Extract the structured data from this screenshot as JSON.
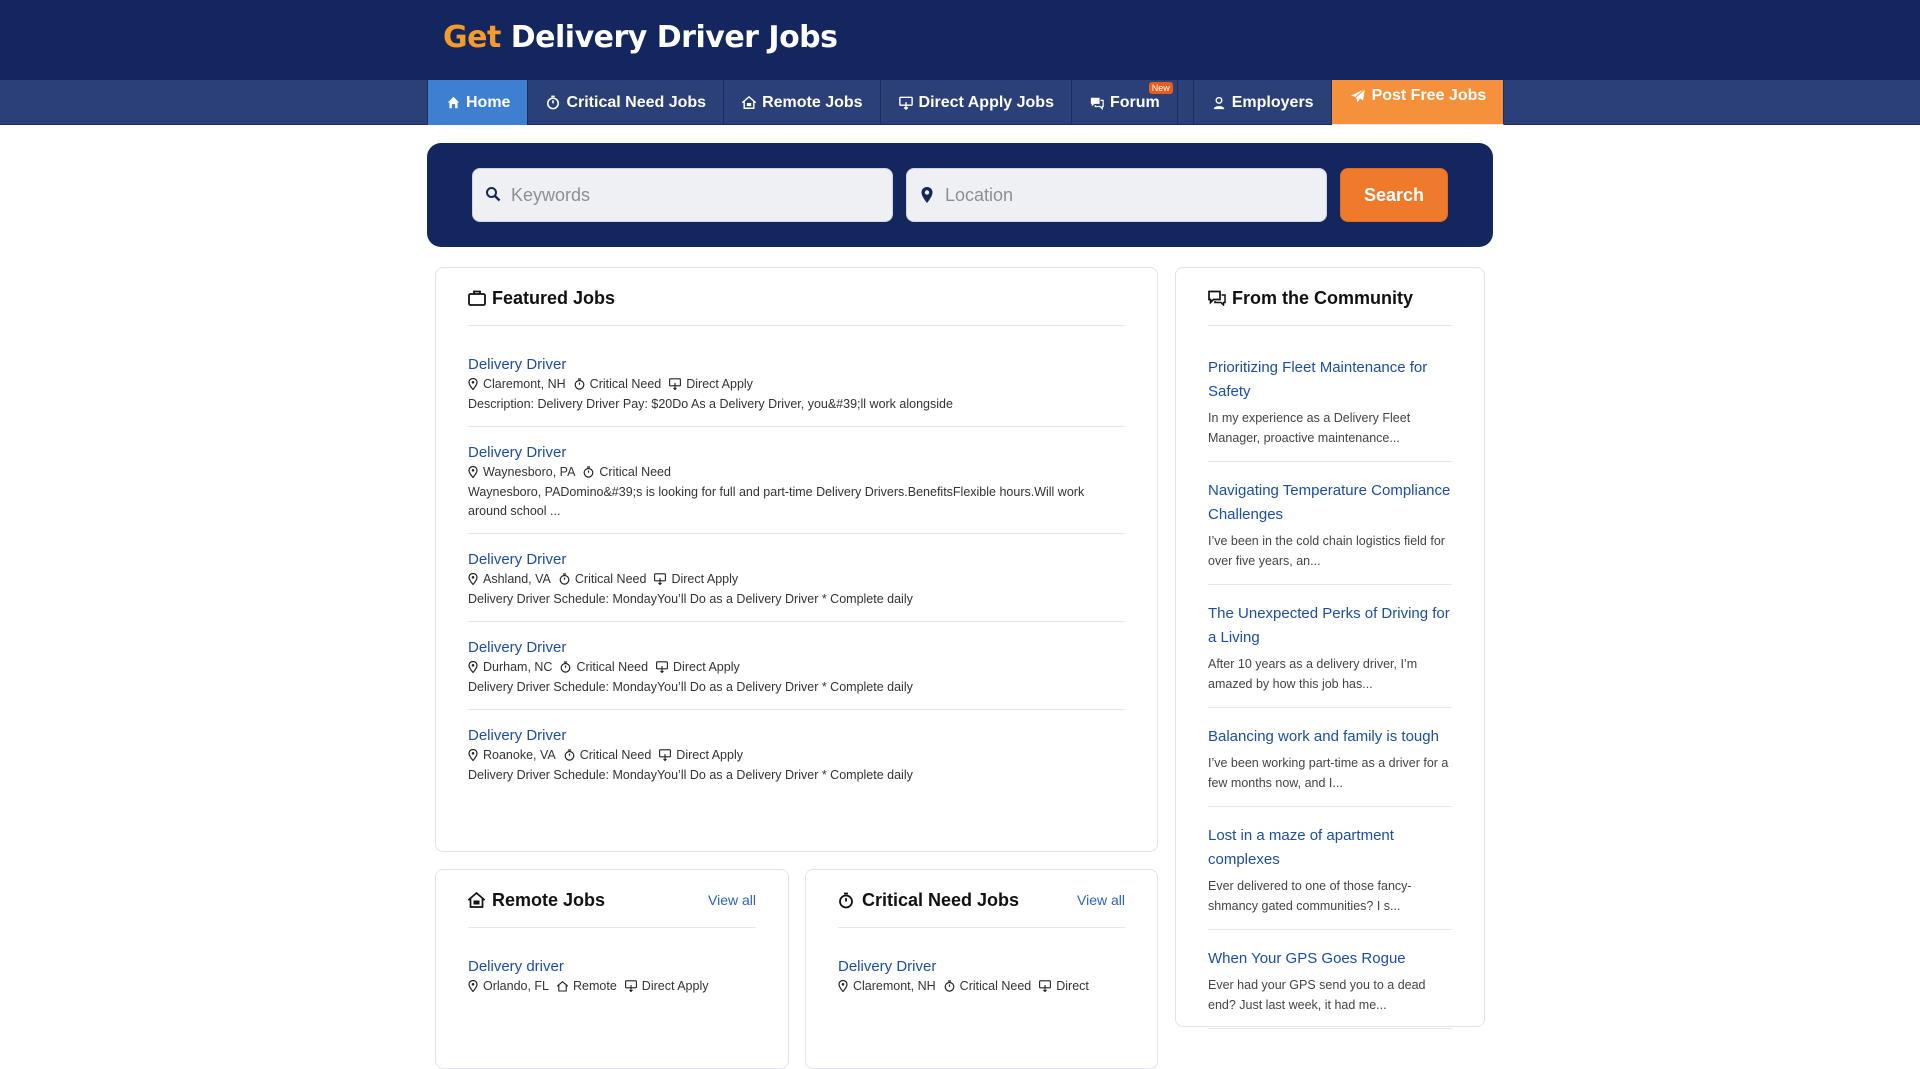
{
  "brand": {
    "get": "Get",
    "rest": "Delivery Driver Jobs"
  },
  "nav": {
    "home": "Home",
    "critical": "Critical Need Jobs",
    "remote": "Remote Jobs",
    "direct": "Direct Apply Jobs",
    "forum": "Forum",
    "forum_badge": "New",
    "employers": "Employers",
    "post": "Post Free Jobs"
  },
  "search": {
    "keywords_placeholder": "Keywords",
    "location_placeholder": "Location",
    "button": "Search"
  },
  "featured": {
    "title": "Featured Jobs",
    "jobs": [
      {
        "title": "Delivery Driver",
        "location": "Claremont, NH",
        "critical": "Critical Need",
        "direct": "Direct Apply",
        "desc": "Description: Delivery Driver Pay: $20Do As a Delivery Driver, you&#39;ll work alongside"
      },
      {
        "title": "Delivery Driver",
        "location": "Waynesboro, PA",
        "critical": "Critical Need",
        "desc": "Waynesboro, PADomino&#39;s is looking for full and part-time Delivery Drivers.BenefitsFlexible hours.Will work around school ..."
      },
      {
        "title": "Delivery Driver",
        "location": "Ashland, VA",
        "critical": "Critical Need",
        "direct": "Direct Apply",
        "desc": "Delivery Driver Schedule: MondayYou’ll Do as a Delivery Driver * Complete daily"
      },
      {
        "title": "Delivery Driver",
        "location": "Durham, NC",
        "critical": "Critical Need",
        "direct": "Direct Apply",
        "desc": "Delivery Driver Schedule: MondayYou’ll Do as a Delivery Driver * Complete daily"
      },
      {
        "title": "Delivery Driver",
        "location": "Roanoke, VA",
        "critical": "Critical Need",
        "direct": "Direct Apply",
        "desc": "Delivery Driver Schedule: MondayYou’ll Do as a Delivery Driver * Complete daily"
      }
    ]
  },
  "community": {
    "title": "From the Community",
    "posts": [
      {
        "title": "Prioritizing Fleet Maintenance for Safety",
        "excerpt": "In my experience as a Delivery Fleet Manager, proactive maintenance..."
      },
      {
        "title": "Navigating Temperature Compliance Challenges",
        "excerpt": "I’ve been in the cold chain logistics field for over five years, an..."
      },
      {
        "title": "The Unexpected Perks of Driving for a Living",
        "excerpt": "After 10 years as a delivery driver, I’m amazed by how this job has..."
      },
      {
        "title": "Balancing work and family is tough",
        "excerpt": "I’ve been working part-time as a driver for a few months now, and I..."
      },
      {
        "title": "Lost in a maze of apartment complexes",
        "excerpt": "Ever delivered to one of those fancy-shmancy gated communities? I s..."
      },
      {
        "title": "When Your GPS Goes Rogue",
        "excerpt": "Ever had your GPS send you to a dead end? Just last week, it had me..."
      }
    ]
  },
  "remote": {
    "title": "Remote Jobs",
    "view_all": "View all",
    "jobs": [
      {
        "title": "Delivery driver",
        "location": "Orlando, FL",
        "remote": "Remote",
        "direct": "Direct Apply"
      }
    ]
  },
  "critical": {
    "title": "Critical Need Jobs",
    "view_all": "View all",
    "jobs": [
      {
        "title": "Delivery Driver",
        "location": "Claremont, NH",
        "critical": "Critical Need",
        "direct": "Direct"
      }
    ]
  },
  "colors": {
    "header": "#13265e",
    "nav": "#2b4077",
    "home": "#3e7fd1",
    "accent": "#f5913a",
    "link": "#1c4ea3"
  }
}
